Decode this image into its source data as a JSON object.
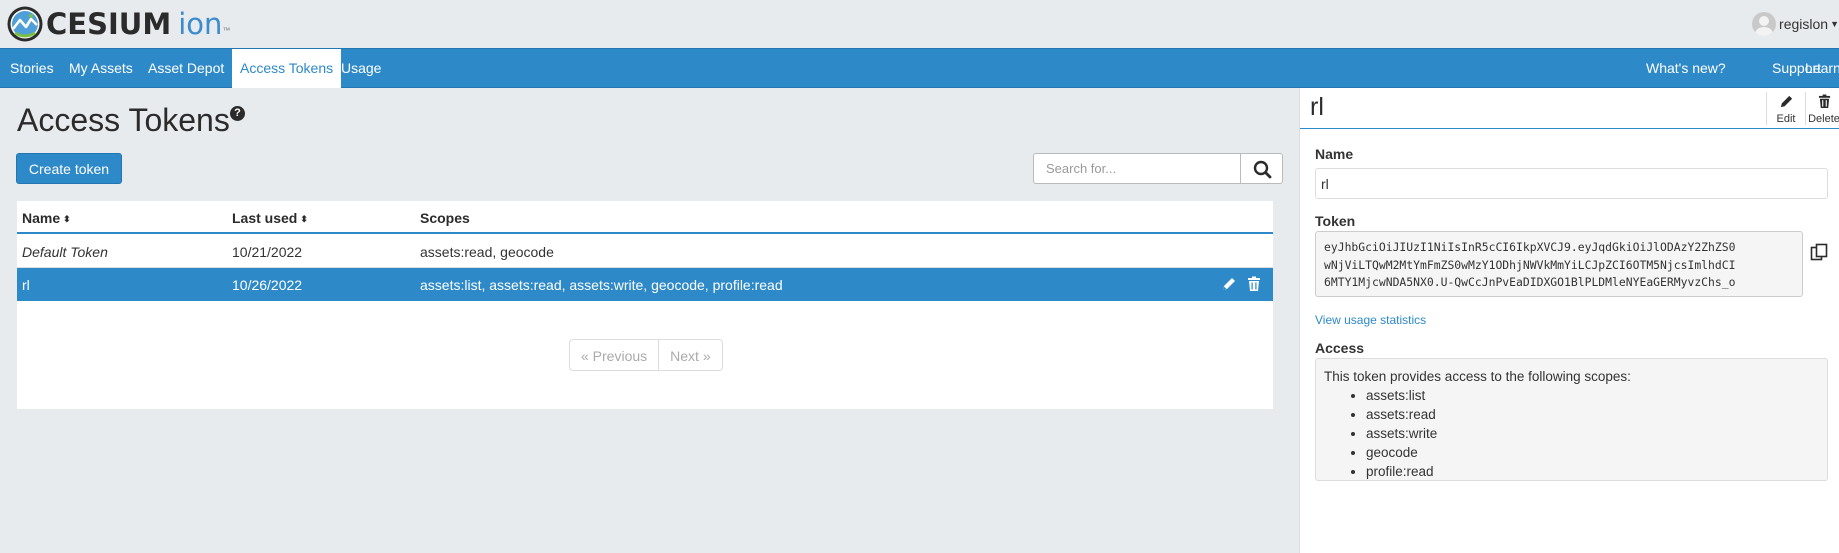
{
  "brand": {
    "name": "CESIUM",
    "suffix": "ion",
    "tm": "™"
  },
  "user": {
    "name": "regislon"
  },
  "nav": {
    "left": [
      "Stories",
      "My Assets",
      "Asset Depot",
      "Access Tokens",
      "Usage"
    ],
    "right": [
      "What's new?",
      "Support",
      "Learn"
    ],
    "active": "Access Tokens"
  },
  "page": {
    "title": "Access Tokens",
    "create_label": "Create token",
    "search_placeholder": "Search for..."
  },
  "table": {
    "columns": [
      "Name",
      "Last used",
      "Scopes"
    ],
    "rows": [
      {
        "name": "Default Token",
        "last_used": "10/21/2022",
        "scopes": "assets:read, geocode"
      },
      {
        "name": "rl",
        "last_used": "10/26/2022",
        "scopes": "assets:list, assets:read, assets:write, geocode, profile:read"
      }
    ]
  },
  "pager": {
    "prev": "« Previous",
    "next": "Next »"
  },
  "panel": {
    "title": "rl",
    "edit_label": "Edit",
    "delete_label": "Delete",
    "name_label": "Name",
    "name_value": "rl",
    "token_label": "Token",
    "token_lines": [
      "eyJhbGciOiJIUzI1NiIsInR5cCI6IkpXVCJ9.eyJqdGkiOiJlODAzY2ZhZS0",
      "wNjViLTQwM2MtYmFmZS0wMzY1ODhjNWVkMmYiLCJpZCI6OTM5NjcsImlhdCI",
      "6MTY1MjcwNDA5NX0.U-QwCcJnPvEaDIDXGO1BlPLDMleNYEaGERMyvzChs_o"
    ],
    "usage_link": "View usage statistics",
    "access_label": "Access",
    "access_intro": "This token provides access to the following scopes:",
    "scopes": [
      "assets:list",
      "assets:read",
      "assets:write",
      "geocode",
      "profile:read"
    ]
  },
  "colors": {
    "accent": "#2d89c8",
    "background": "#e8ebee"
  }
}
